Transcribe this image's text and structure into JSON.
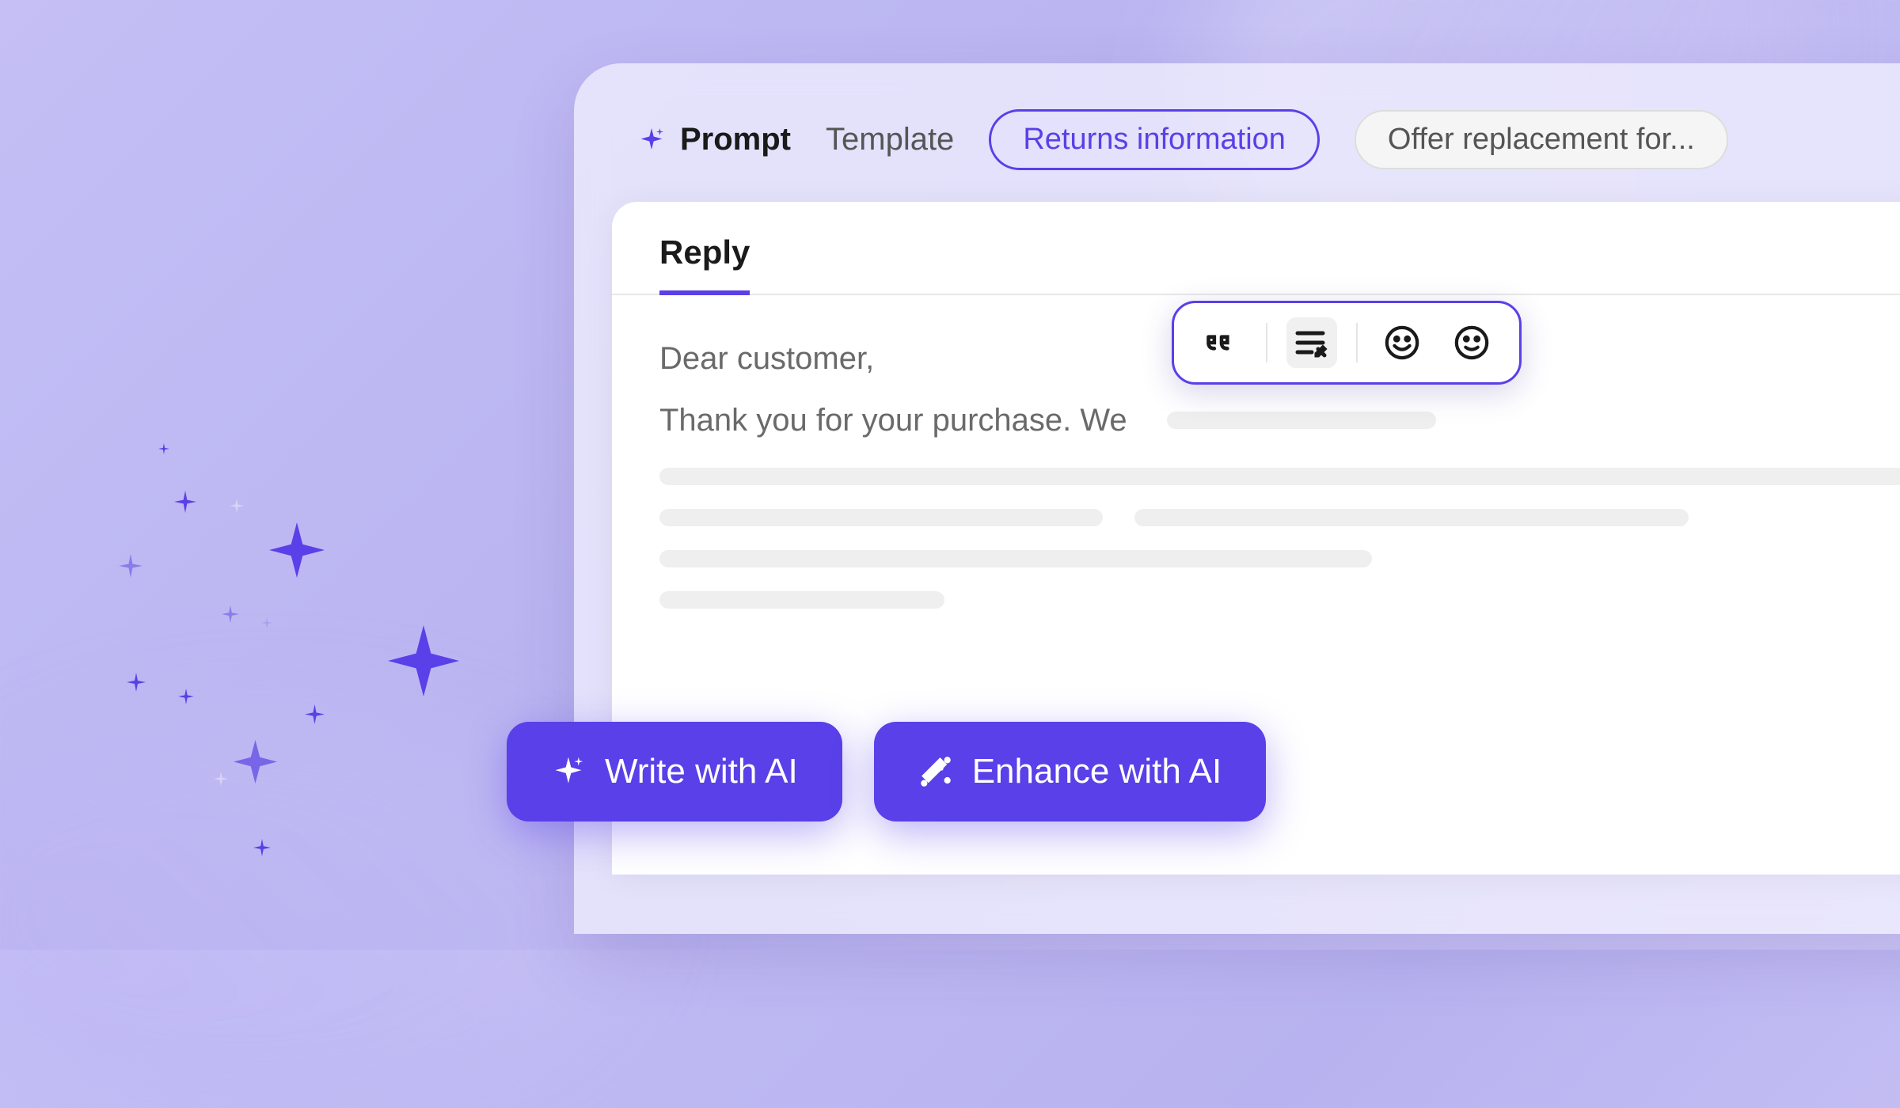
{
  "tabs": {
    "prompt": "Prompt",
    "template": "Template"
  },
  "chips": {
    "returns": "Returns information",
    "offer": "Offer replacement for..."
  },
  "reply": {
    "tab_label": "Reply",
    "greeting": "Dear customer,",
    "body": "Thank you for your purchase. We"
  },
  "toolbar": {
    "quote": "quote",
    "edit": "edit",
    "emoji1": "emoji",
    "emoji2": "emoji"
  },
  "actions": {
    "write": "Write with AI",
    "enhance": "Enhance with AI"
  },
  "colors": {
    "primary": "#5940e8",
    "background": "#c4bff5"
  }
}
